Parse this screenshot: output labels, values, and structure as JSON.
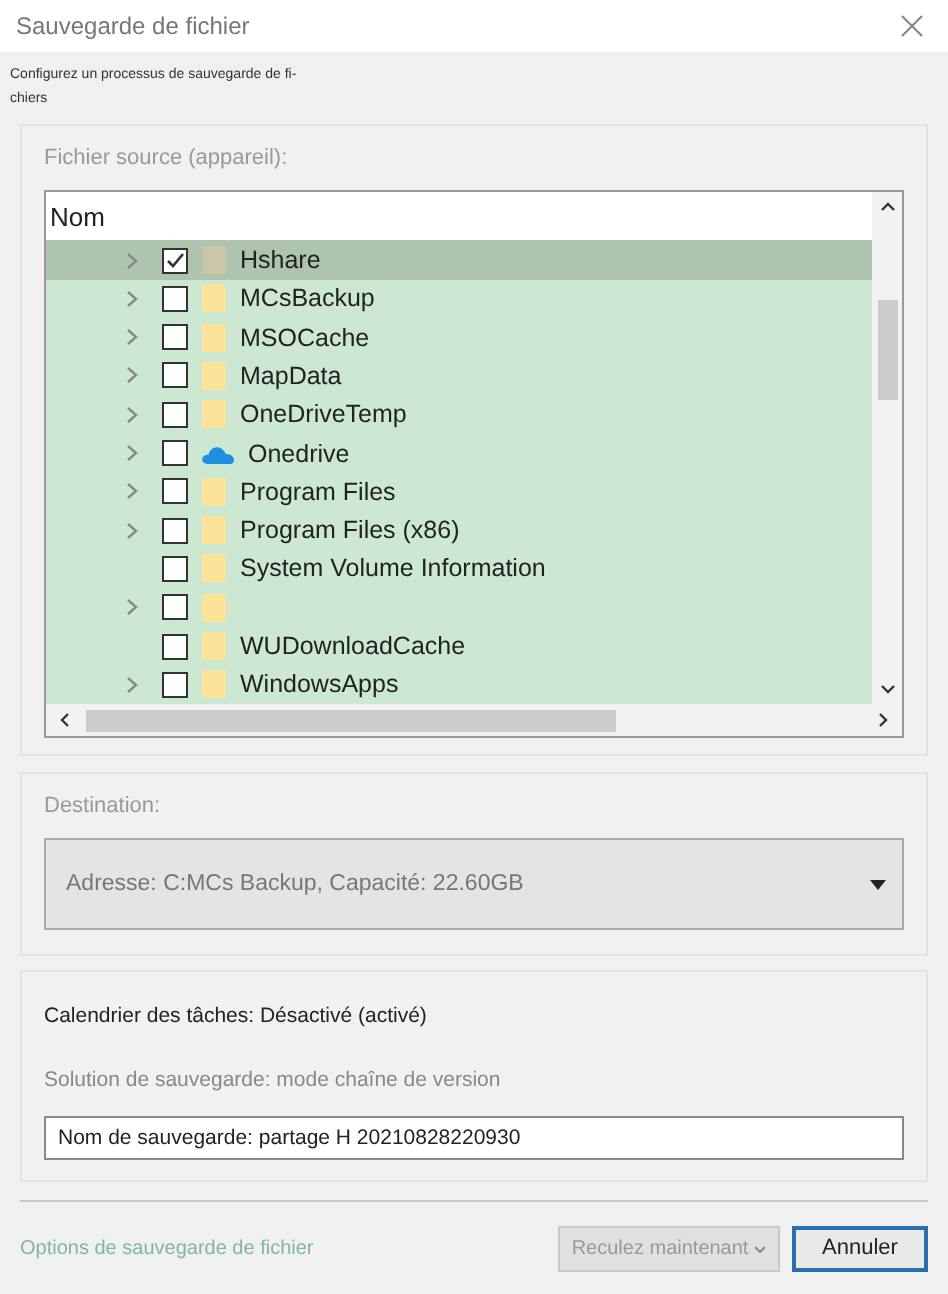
{
  "window": {
    "title": "Sauvegarde de fichier"
  },
  "description": "Configurez un processus de sauvegarde de fi-chiers",
  "source": {
    "label": "Fichier source (appareil):",
    "columns": [
      "Nom"
    ],
    "rows": [
      {
        "name": "Hshare",
        "kind": "folder",
        "expandable": true,
        "checked": true,
        "selected": true
      },
      {
        "name": "MCsBackup",
        "kind": "folder",
        "expandable": true,
        "checked": false,
        "selected": false
      },
      {
        "name": "MSOCache",
        "kind": "folder",
        "expandable": true,
        "checked": false,
        "selected": false
      },
      {
        "name": "MapData",
        "kind": "folder",
        "expandable": true,
        "checked": false,
        "selected": false
      },
      {
        "name": "OneDriveTemp",
        "kind": "folder",
        "expandable": true,
        "checked": false,
        "selected": false
      },
      {
        "name": "Onedrive",
        "kind": "cloud",
        "expandable": true,
        "checked": false,
        "selected": false
      },
      {
        "name": "Program Files",
        "kind": "folder",
        "expandable": true,
        "checked": false,
        "selected": false
      },
      {
        "name": "Program Files (x86)",
        "kind": "folder",
        "expandable": true,
        "checked": false,
        "selected": false
      },
      {
        "name": "System Volume Information",
        "kind": "folder",
        "expandable": false,
        "checked": false,
        "selected": false
      },
      {
        "kind": "folder",
        "expandable": true,
        "checked": false,
        "selected": false
      },
      {
        "name": "WUDownloadCache",
        "kind": "folder",
        "expandable": false,
        "checked": false,
        "selected": false
      },
      {
        "name": "WindowsApps",
        "kind": "folder",
        "expandable": true,
        "checked": false,
        "selected": false
      }
    ]
  },
  "destination": {
    "label": "Destination:",
    "value": "Adresse: C:MCs Backup, Capacité: 22.60GB"
  },
  "schedule": "Calendrier des tâches: Désactivé (activé)",
  "solution": "Solution de sauvegarde: mode chaîne de version",
  "backup_name": {
    "value": "Nom de sauvegarde: partage H 20210828220930"
  },
  "options_link": "Options de sauvegarde de fichier",
  "buttons": [
    {
      "label": "Reculez maintenant",
      "kind": "split"
    },
    {
      "label": "Annuler",
      "kind": "default"
    }
  ]
}
